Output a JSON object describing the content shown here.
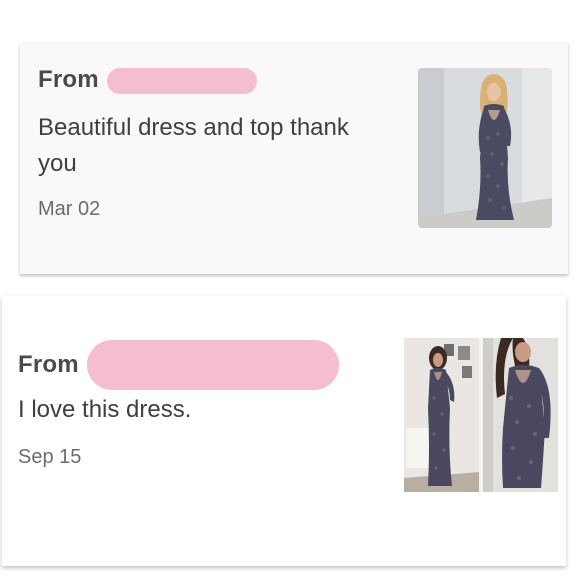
{
  "reviews": [
    {
      "from_label": "From",
      "text": "Beautiful dress and top thank you",
      "date": "Mar 02",
      "photo_icon": "dress-photo-icon"
    },
    {
      "from_label": "From",
      "text": "I love this dress.",
      "date": "Sep 15",
      "photo_icon": "dress-photo-icon"
    }
  ],
  "colors": {
    "redaction": "#f5bed0",
    "card_bg": "#fbf8f9",
    "text": "#3f3f3f"
  }
}
